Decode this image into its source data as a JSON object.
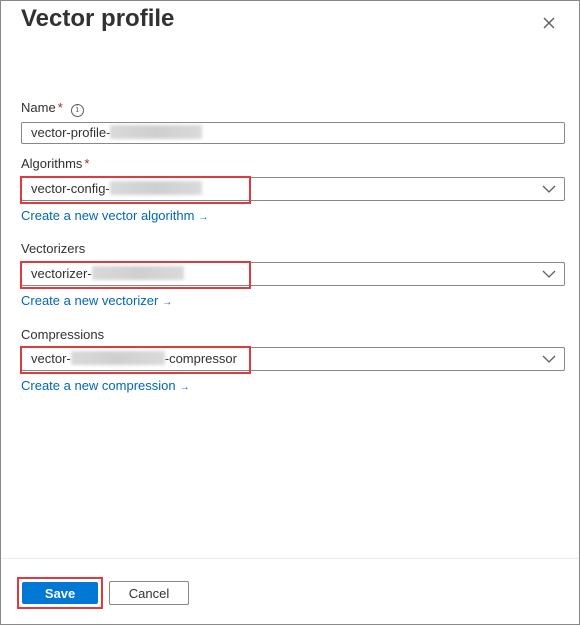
{
  "panel": {
    "title": "Vector profile",
    "close_icon": "close-icon"
  },
  "name_field": {
    "label": "Name",
    "required_mark": "*",
    "info_glyph": "i",
    "value_prefix": "vector-profile-"
  },
  "algorithms": {
    "label": "Algorithms",
    "required_mark": "*",
    "value_prefix": "vector-config-",
    "create_link": "Create a new vector algorithm",
    "arrow": "→"
  },
  "vectorizers": {
    "label": "Vectorizers",
    "value_prefix": "vectorizer-",
    "create_link": "Create a new vectorizer",
    "arrow": "→"
  },
  "compressions": {
    "label": "Compressions",
    "value_prefix": "vector-",
    "value_suffix": "-compressor",
    "create_link": "Create a new compression",
    "arrow": "→"
  },
  "footer": {
    "save_label": "Save",
    "cancel_label": "Cancel"
  },
  "colors": {
    "accent": "#0078d4",
    "link": "#0067b8",
    "highlight": "#e03a3e",
    "required": "#a4262c"
  }
}
